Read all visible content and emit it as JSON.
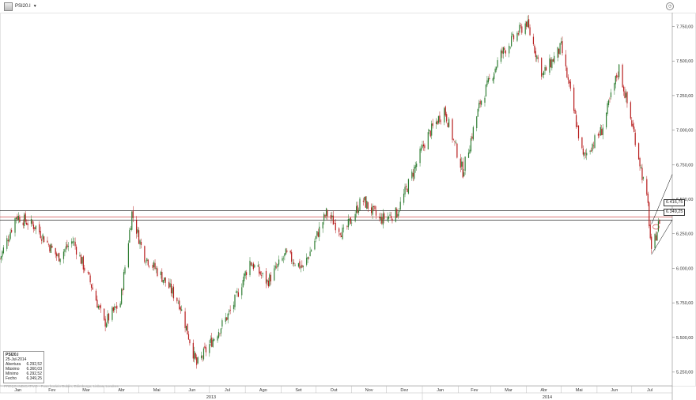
{
  "window": {
    "symbol": "PSI20.I",
    "dropdown_icon": "caret-down-icon",
    "clock_icon": "clock-icon"
  },
  "info": {
    "title": "PSI20.I",
    "date": "25-Jul-2014",
    "rows": [
      {
        "label": "Abertura",
        "value": "6.292,52"
      },
      {
        "label": "Máximo",
        "value": "6.360,03"
      },
      {
        "label": "Mínimo",
        "value": "6.292,52"
      },
      {
        "label": "Fecho",
        "value": "6.349,25"
      }
    ]
  },
  "footer": "PREÇO INDICATIVO - Fuso horário Dublin, Edimburgo, Lisboa, Londres",
  "price_tags": {
    "upper": "6.416,75",
    "lower": "6.349,25"
  },
  "colors": {
    "up": "#2e7d32",
    "down": "#b71c1c",
    "line": "#000000",
    "red_line": "#c62828"
  },
  "chart_data": {
    "type": "candlestick",
    "ylim": [
      5150,
      7850
    ],
    "yticks": [
      5250,
      5500,
      5750,
      6000,
      6250,
      6500,
      6750,
      7000,
      7250,
      7500,
      7750
    ],
    "ytick_labels": [
      "5.250,00",
      "5.500,00",
      "5.750,00",
      "6.000,00",
      "6.250,00",
      "6.500,00",
      "6.750,00",
      "7.000,00",
      "7.250,00",
      "7.500,00",
      "7.750,00"
    ],
    "months": [
      "Jan",
      "Fev",
      "Mar",
      "Abr",
      "Mai",
      "Jun",
      "Jul",
      "Ago",
      "Set",
      "Out",
      "Nov",
      "Dez",
      "Jan",
      "Fev",
      "Mar",
      "Abr",
      "Mai",
      "Jun",
      "Jul"
    ],
    "years": [
      "2013",
      "2014"
    ],
    "horizontal_lines": [
      6416.75,
      6349.25,
      6370
    ],
    "key_points": [
      [
        "2013-01-01",
        6070
      ],
      [
        "2013-01-15",
        6380
      ],
      [
        "2013-02-01",
        6300
      ],
      [
        "2013-02-20",
        6080
      ],
      [
        "2013-03-05",
        6200
      ],
      [
        "2013-03-20",
        5900
      ],
      [
        "2013-04-01",
        5600
      ],
      [
        "2013-04-15",
        5750
      ],
      [
        "2013-04-25",
        6400
      ],
      [
        "2013-05-05",
        6100
      ],
      [
        "2013-05-20",
        5950
      ],
      [
        "2013-06-05",
        5750
      ],
      [
        "2013-06-20",
        5300
      ],
      [
        "2013-07-05",
        5500
      ],
      [
        "2013-07-20",
        5700
      ],
      [
        "2013-08-05",
        6050
      ],
      [
        "2013-08-20",
        5900
      ],
      [
        "2013-09-05",
        6100
      ],
      [
        "2013-09-20",
        6000
      ],
      [
        "2013-10-10",
        6400
      ],
      [
        "2013-10-25",
        6250
      ],
      [
        "2013-11-10",
        6500
      ],
      [
        "2013-11-25",
        6350
      ],
      [
        "2013-12-10",
        6400
      ],
      [
        "2014-01-05",
        6950
      ],
      [
        "2014-01-20",
        7150
      ],
      [
        "2014-02-05",
        6700
      ],
      [
        "2014-02-20",
        7200
      ],
      [
        "2014-03-10",
        7550
      ],
      [
        "2014-04-01",
        7780
      ],
      [
        "2014-04-15",
        7400
      ],
      [
        "2014-05-01",
        7600
      ],
      [
        "2014-05-20",
        6800
      ],
      [
        "2014-06-05",
        7000
      ],
      [
        "2014-06-20",
        7450
      ],
      [
        "2014-07-05",
        6900
      ],
      [
        "2014-07-15",
        6450
      ],
      [
        "2014-07-18",
        6100
      ],
      [
        "2014-07-25",
        6349
      ]
    ]
  }
}
